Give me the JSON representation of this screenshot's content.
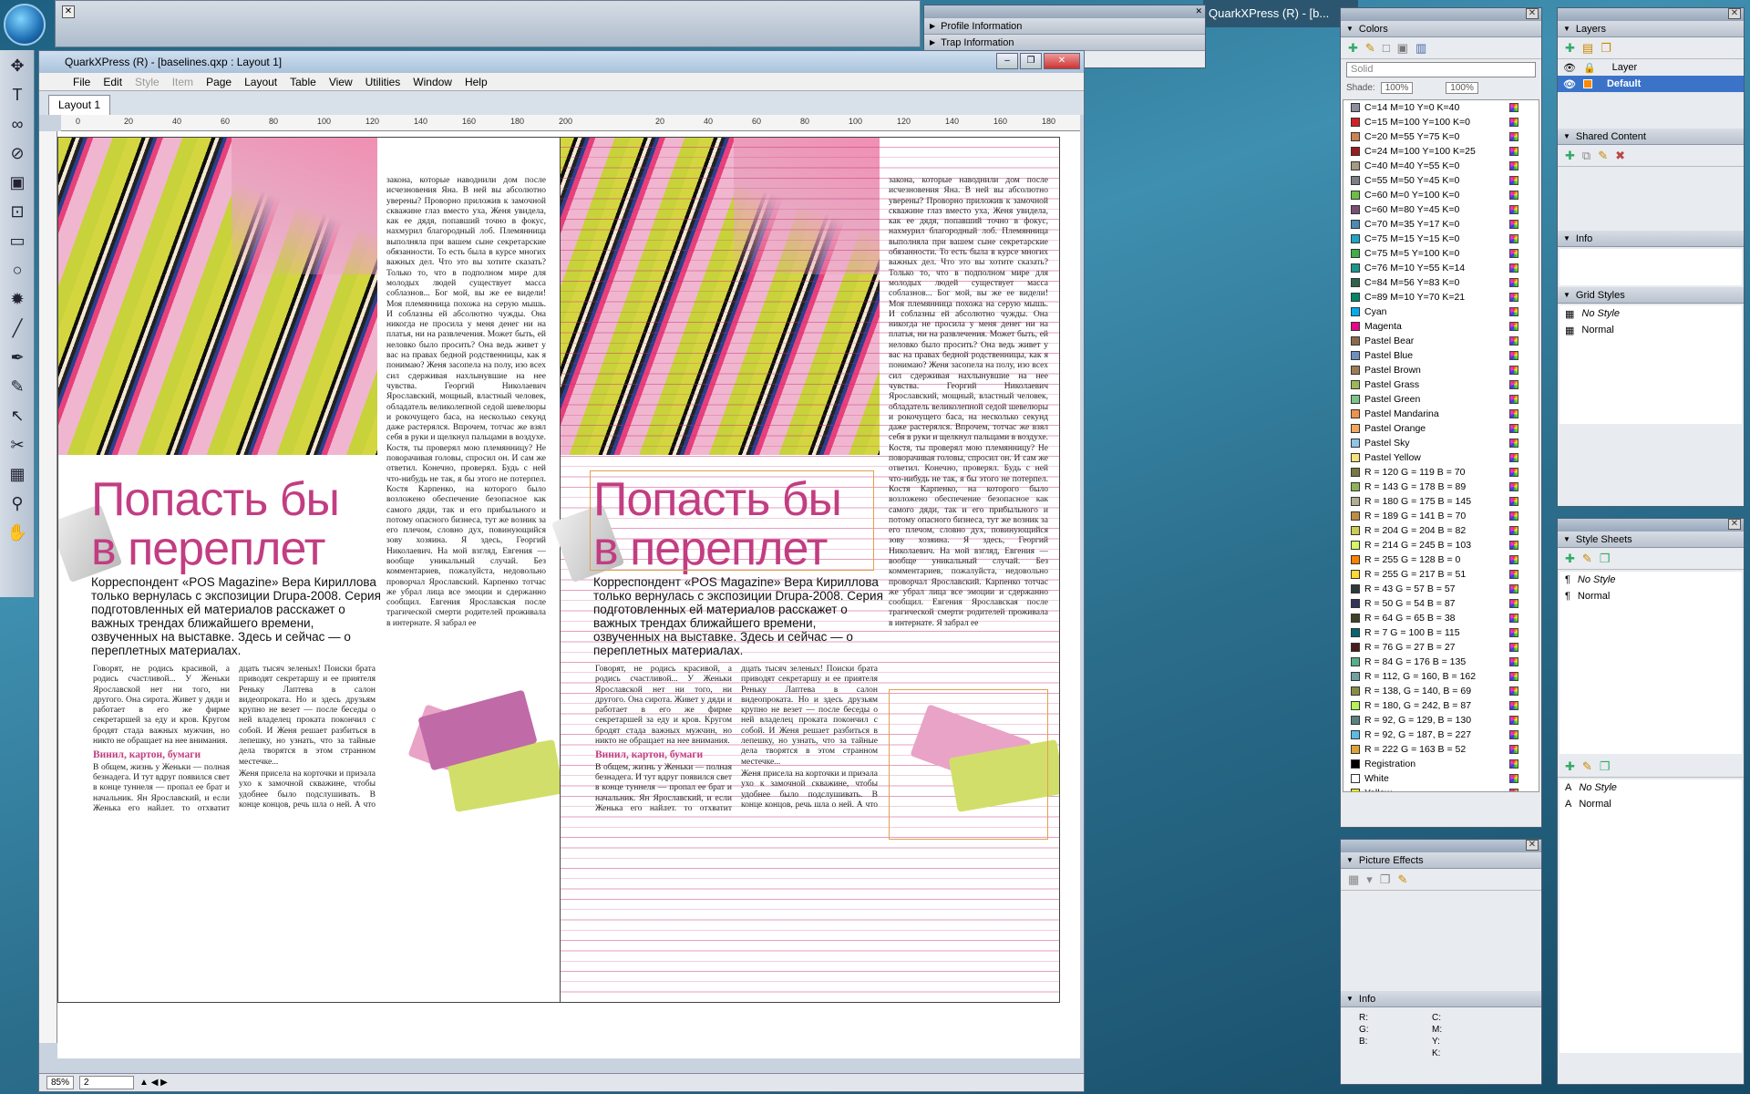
{
  "app": {
    "background_window_title": "QuarkXPress (R) - [b...",
    "window_title": "QuarkXPress (R) - [baselines.qxp : Layout 1]"
  },
  "menu": [
    "File",
    "Edit",
    "Style",
    "Item",
    "Page",
    "Layout",
    "Table",
    "View",
    "Utilities",
    "Window",
    "Help"
  ],
  "menu_disabled": [
    "Style",
    "Item"
  ],
  "tab": {
    "label": "Layout 1"
  },
  "ruler_labels": [
    "0",
    "20",
    "40",
    "60",
    "80",
    "100",
    "120",
    "140",
    "160",
    "180",
    "200",
    "",
    "20",
    "40",
    "60",
    "80",
    "100",
    "120",
    "140",
    "160",
    "180",
    "200"
  ],
  "floating_palette": {
    "items": [
      "Profile Information",
      "Trap Information"
    ]
  },
  "status": {
    "zoom": "85%",
    "page": "2"
  },
  "article": {
    "headline_line1": "Попасть бы",
    "headline_line2": "в переплет",
    "lead": "Корреспондент «POS Magazine» Вера Кириллова только вернулась с экспозиции Drupa-2008. Серия подготовленных ей материалов расскажет о важных трендах ближайшего времени, озвученных на выставке. Здесь и сейчас — о переплетных материалах.",
    "col1": "Говорят, не родись красивой, а родись счастливой... У Женьки Ярославской нет ни того, ни другого. Она сирота. Живет у дяди и работает в его же фирме секретаршей за еду и кров. Кругом бродят стада важных мужчин, но никто не обращает на нее внимания.",
    "subhead": "Винил, картон, бумаги",
    "col1b": "В общем, жизнь у Женьки — полная безнадега. И тут вдруг появился свет в конце туннеля — пропал ее брат и начальник. Ян Ярославский, и если Женька его найдет, то отхватит награду, два-",
    "col2": "дцать тысяч зеленых! Поиски брата приводят секретаршу и ее приятеля Реньку Лаптева в салон видеопроката. Но и здесь друзьям крупно не везет — после беседы о ней владелец проката покончил с собой. И Женя решает разбиться в лепешку, но узнать, что за тайные дела творятся в этом странном местечке...",
    "col2b": "Женя присела на корточки и приэала ухо к замочной скважине, чтобы удобнее было подслушивать. В конце концов, речь шла о ней. А что ваша племянница? Спросил один из представителей",
    "col3": "закона, которые наводнили дом после исчезновения Яна. В ней вы абсолютно уверены? Проворно приложив к замочной скважине глаз вместо уха, Женя увидела, как ее дядя, попавший точно в фокус, нахмурил благородный лоб. Племянница выполняла при вашем сыне секретарские обязанности. То есть была в курсе многих важных дел. Что это вы хотите сказать? Только то, что в подполном мире для молодых людей существует масса соблазнов... Бог мой, вы же ее видели! Моя племянница похожа на серую мышь. И соблазны ей абсолютно чужды. Она никогда не просила у меня денег ни на платья, ни на развлечения. Может быть, ей неловко было просить? Она ведь живет у вас на правах бедной родственницы, как я понимаю? Женя засопела на полу, изо всех сил сдерживая нахлынувшие на нее чувства. Георгий Николаевич Ярославский, мощный, властный человек, обладатель великолепной седой шевелюры и рокочущего баса, на несколько секунд даже растерялся. Впрочем, тотчас же взял себя в руки и щелкнул пальцами в воздухе. Костя, ты проверял мою племянницу? Не поворачивая головы, спросил он. И сам же ответил. Конечно, проверял. Будь с ней что-нибудь не так, я бы этого не потерпел. Костя Карпенко, на которого было возложено обеспечение безопасное как самого дяди, так и его прибыльного и потому опасного бизнеса, тут же возник за его плечом, словно дух, повинующийся зову хозяина. Я здесь, Георгий Николаевич. На мой взгляд, Евгения — вообще уникальный случай. Без комментариев, пожалуйста, недовольно проворчал Ярославский. Карпенко тотчас же убрал лица все эмоции и сдержанно сообщил. Евгения Ярославская после трагической смерти родителей проживала в интернате. Я забрал ее"
  },
  "colors_palette": {
    "title": "Colors",
    "fill_type": "Solid",
    "shade_label": "Shade:",
    "shade_value": "100%",
    "opacity_value": "100%",
    "swatches": [
      {
        "name": "C=14 M=10 Y=0 K=40",
        "color": "#8b8f9e"
      },
      {
        "name": "C=15 M=100 Y=100 K=0",
        "color": "#d41f26"
      },
      {
        "name": "C=20 M=55 Y=75 K=0",
        "color": "#cc8352"
      },
      {
        "name": "C=24 M=100 Y=100 K=25",
        "color": "#9b1b1e"
      },
      {
        "name": "C=40 M=40 Y=55 K=0",
        "color": "#a69a80"
      },
      {
        "name": "C=55 M=50 Y=45 K=0",
        "color": "#7d7f84"
      },
      {
        "name": "C=60 M=0 Y=100 K=0",
        "color": "#6cbe45"
      },
      {
        "name": "C=60 M=80 Y=45 K=0",
        "color": "#7a4f73"
      },
      {
        "name": "C=70 M=35 Y=17 K=0",
        "color": "#4b8ab3"
      },
      {
        "name": "C=75 M=15 Y=15 K=0",
        "color": "#1ea3c9"
      },
      {
        "name": "C=75 M=5 Y=100 K=0",
        "color": "#3fae49"
      },
      {
        "name": "C=76 M=10 Y=55 K=14",
        "color": "#1a978a"
      },
      {
        "name": "C=84 M=56 Y=83 K=0",
        "color": "#2f6448"
      },
      {
        "name": "C=89 M=10 Y=70 K=21",
        "color": "#00876a"
      },
      {
        "name": "Cyan",
        "color": "#00aeef"
      },
      {
        "name": "Magenta",
        "color": "#ec008c"
      },
      {
        "name": "Pastel Bear",
        "color": "#8a6a4c"
      },
      {
        "name": "Pastel Blue",
        "color": "#6f8fc0"
      },
      {
        "name": "Pastel Brown",
        "color": "#9d7c58"
      },
      {
        "name": "Pastel Grass",
        "color": "#9ab859"
      },
      {
        "name": "Pastel Green",
        "color": "#7bc48c"
      },
      {
        "name": "Pastel Mandarina",
        "color": "#f0924d"
      },
      {
        "name": "Pastel Orange",
        "color": "#f5a65b"
      },
      {
        "name": "Pastel Sky",
        "color": "#8ec5e8"
      },
      {
        "name": "Pastel Yellow",
        "color": "#f6e27a"
      },
      {
        "name": "R = 120 G = 119 B = 70",
        "color": "#787746"
      },
      {
        "name": "R = 143 G = 178 B = 89",
        "color": "#8fb259"
      },
      {
        "name": "R = 180 G = 175 B = 145",
        "color": "#b4af91"
      },
      {
        "name": "R = 189 G = 141 B = 70",
        "color": "#bd8d46"
      },
      {
        "name": "R = 204 G = 204 B = 82",
        "color": "#cccc52"
      },
      {
        "name": "R = 214 G = 245 B = 103",
        "color": "#d6f567"
      },
      {
        "name": "R = 255 G = 128 B = 0",
        "color": "#ff8000"
      },
      {
        "name": "R = 255 G = 217 B = 51",
        "color": "#ffd933"
      },
      {
        "name": "R = 43 G = 57 B = 57",
        "color": "#2b3939"
      },
      {
        "name": "R = 50 G = 54 B = 87",
        "color": "#323657"
      },
      {
        "name": "R = 64 G = 65 B = 38",
        "color": "#404126"
      },
      {
        "name": "R = 7 G = 100 B = 115",
        "color": "#076473"
      },
      {
        "name": "R = 76 G = 27 B = 27",
        "color": "#4c1b1b"
      },
      {
        "name": "R = 84 G = 176 B = 135",
        "color": "#54b087"
      },
      {
        "name": "R = 112, G = 160, B = 162",
        "color": "#70a0a2"
      },
      {
        "name": "R = 138, G = 140, B = 69",
        "color": "#8a8c45"
      },
      {
        "name": "R = 180, G = 242, B = 87",
        "color": "#b4f257"
      },
      {
        "name": "R = 92, G = 129, B = 130",
        "color": "#5c8182"
      },
      {
        "name": "R = 92, G = 187, B = 227",
        "color": "#5cbbe3"
      },
      {
        "name": "R = 222 G = 163 B = 52",
        "color": "#dea334"
      },
      {
        "name": "Registration",
        "color": "#000000"
      },
      {
        "name": "White",
        "color": "#ffffff"
      },
      {
        "name": "Yellow",
        "color": "#fff200"
      }
    ]
  },
  "picture_effects": {
    "title": "Picture Effects"
  },
  "info_palette": {
    "title": "Info",
    "fields": [
      "R:",
      "G:",
      "B:",
      "C:",
      "M:",
      "Y:",
      "K:"
    ]
  },
  "layers": {
    "title": "Layers",
    "header": "Layer",
    "items": [
      "Default"
    ]
  },
  "shared_content": {
    "title": "Shared Content"
  },
  "info2": {
    "title": "Info"
  },
  "grid_styles": {
    "title": "Grid Styles",
    "items": [
      "No Style",
      "Normal"
    ]
  },
  "style_sheets": {
    "title": "Style Sheets",
    "paragraph": [
      "No Style",
      "Normal"
    ],
    "character": [
      "No Style",
      "Normal"
    ]
  }
}
